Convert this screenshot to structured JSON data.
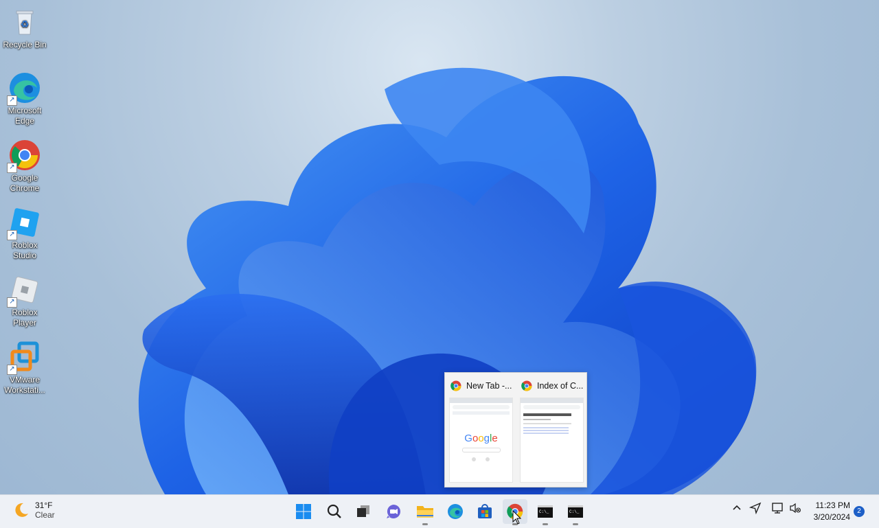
{
  "desktop": {
    "icons": [
      {
        "label_line1": "Recycle Bin",
        "label_line2": ""
      },
      {
        "label_line1": "Microsoft",
        "label_line2": "Edge"
      },
      {
        "label_line1": "Google",
        "label_line2": "Chrome"
      },
      {
        "label_line1": "Roblox",
        "label_line2": "Studio"
      },
      {
        "label_line1": "Roblox",
        "label_line2": "Player"
      },
      {
        "label_line1": "VMware",
        "label_line2": "Workstati..."
      }
    ]
  },
  "thumbnails": [
    {
      "title": "New Tab -...",
      "icon": "chrome-icon"
    },
    {
      "title": "Index of C...",
      "icon": "chrome-icon"
    }
  ],
  "taskbar": {
    "weather": {
      "temp": "31°F",
      "condition": "Clear",
      "icon": "moon-icon"
    },
    "apps": [
      "start",
      "search",
      "task-view",
      "teams-chat",
      "file-explorer",
      "edge",
      "microsoft-store",
      "chrome",
      "terminal",
      "terminal"
    ],
    "clock": {
      "time": "11:23 PM",
      "date": "3/20/2024"
    },
    "notification_count": "2"
  },
  "colors": {
    "accent": "#1d5fc7",
    "taskbar": "#eef1f6"
  }
}
